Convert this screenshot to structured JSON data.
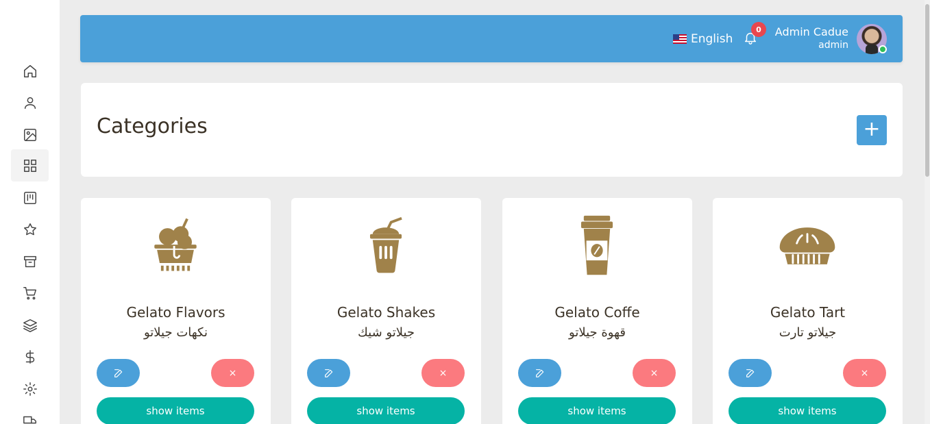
{
  "header": {
    "language": "English",
    "notification_count": "0",
    "user_name": "Admin Cadue",
    "user_role": "admin"
  },
  "page": {
    "title": "Categories",
    "add_label": "+"
  },
  "categories": [
    {
      "name": "Gelato Flavors",
      "name_ar": "نكهات جيلاتو",
      "icon": "ice-cream-cup-icon",
      "show_label": "show items",
      "delete_label": "×"
    },
    {
      "name": "Gelato Shakes",
      "name_ar": "جيلاتو شيك",
      "icon": "shake-cup-icon",
      "show_label": "show items",
      "delete_label": "×"
    },
    {
      "name": "Gelato Coffe",
      "name_ar": "قهوة جيلاتو",
      "icon": "coffee-cup-icon",
      "show_label": "show items",
      "delete_label": "×"
    },
    {
      "name": "Gelato Tart",
      "name_ar": "جيلاتو تارت",
      "icon": "tart-icon",
      "show_label": "show items",
      "delete_label": "×"
    }
  ],
  "sidebar": {
    "items": [
      "home-icon",
      "user-icon",
      "image-icon",
      "grid-icon",
      "board-icon",
      "star-icon",
      "archive-icon",
      "cart-icon",
      "layers-icon",
      "dollar-icon",
      "settings-icon",
      "truck-icon"
    ],
    "active": "grid-icon"
  },
  "colors": {
    "primary": "#4ba0d9",
    "danger": "#fb7a7f",
    "teal": "#05b3a5",
    "icon_brown": "#a0824a"
  }
}
